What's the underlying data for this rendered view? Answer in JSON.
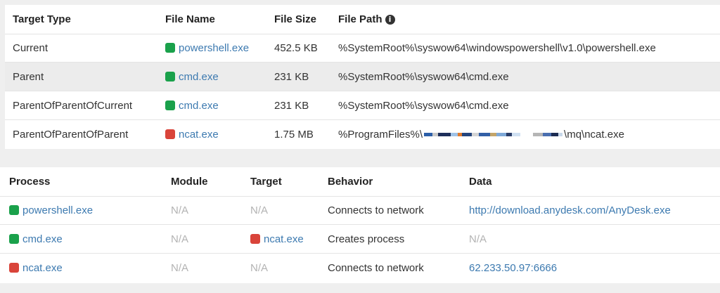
{
  "files_table": {
    "headers": {
      "target_type": "Target Type",
      "file_name": "File Name",
      "file_size": "File Size",
      "file_path": "File Path"
    },
    "rows": [
      {
        "target_type": "Current",
        "file_name": "powershell.exe",
        "status": "green",
        "file_size": "452.5 KB",
        "file_path": "%SystemRoot%\\syswow64\\windowspowershell\\v1.0\\powershell.exe"
      },
      {
        "target_type": "Parent",
        "file_name": "cmd.exe",
        "status": "green",
        "file_size": "231 KB",
        "file_path": "%SystemRoot%\\syswow64\\cmd.exe"
      },
      {
        "target_type": "ParentOfParentOfCurrent",
        "file_name": "cmd.exe",
        "status": "green",
        "file_size": "231 KB",
        "file_path": "%SystemRoot%\\syswow64\\cmd.exe"
      },
      {
        "target_type": "ParentOfParentOfParent",
        "file_name": "ncat.exe",
        "status": "red",
        "file_size": "1.75 MB",
        "file_path_prefix": "%ProgramFiles%\\",
        "file_path_suffix": "\\mq\\ncat.exe"
      }
    ]
  },
  "behavior_table": {
    "headers": {
      "process": "Process",
      "module": "Module",
      "target": "Target",
      "behavior": "Behavior",
      "data": "Data"
    },
    "rows": [
      {
        "process": "powershell.exe",
        "process_status": "green",
        "module": "N/A",
        "target": "N/A",
        "behavior": "Connects to network",
        "data": "http://download.anydesk.com/AnyDesk.exe"
      },
      {
        "process": "cmd.exe",
        "process_status": "green",
        "module": "N/A",
        "target": "ncat.exe",
        "target_status": "red",
        "behavior": "Creates process",
        "data": "N/A"
      },
      {
        "process": "ncat.exe",
        "process_status": "red",
        "module": "N/A",
        "target": "N/A",
        "behavior": "Connects to network",
        "data": "62.233.50.97:6666"
      }
    ]
  },
  "colors": {
    "green": "#1aa14b",
    "red": "#d9443a",
    "link": "#3d7ab0",
    "na": "#b3b3b3"
  }
}
